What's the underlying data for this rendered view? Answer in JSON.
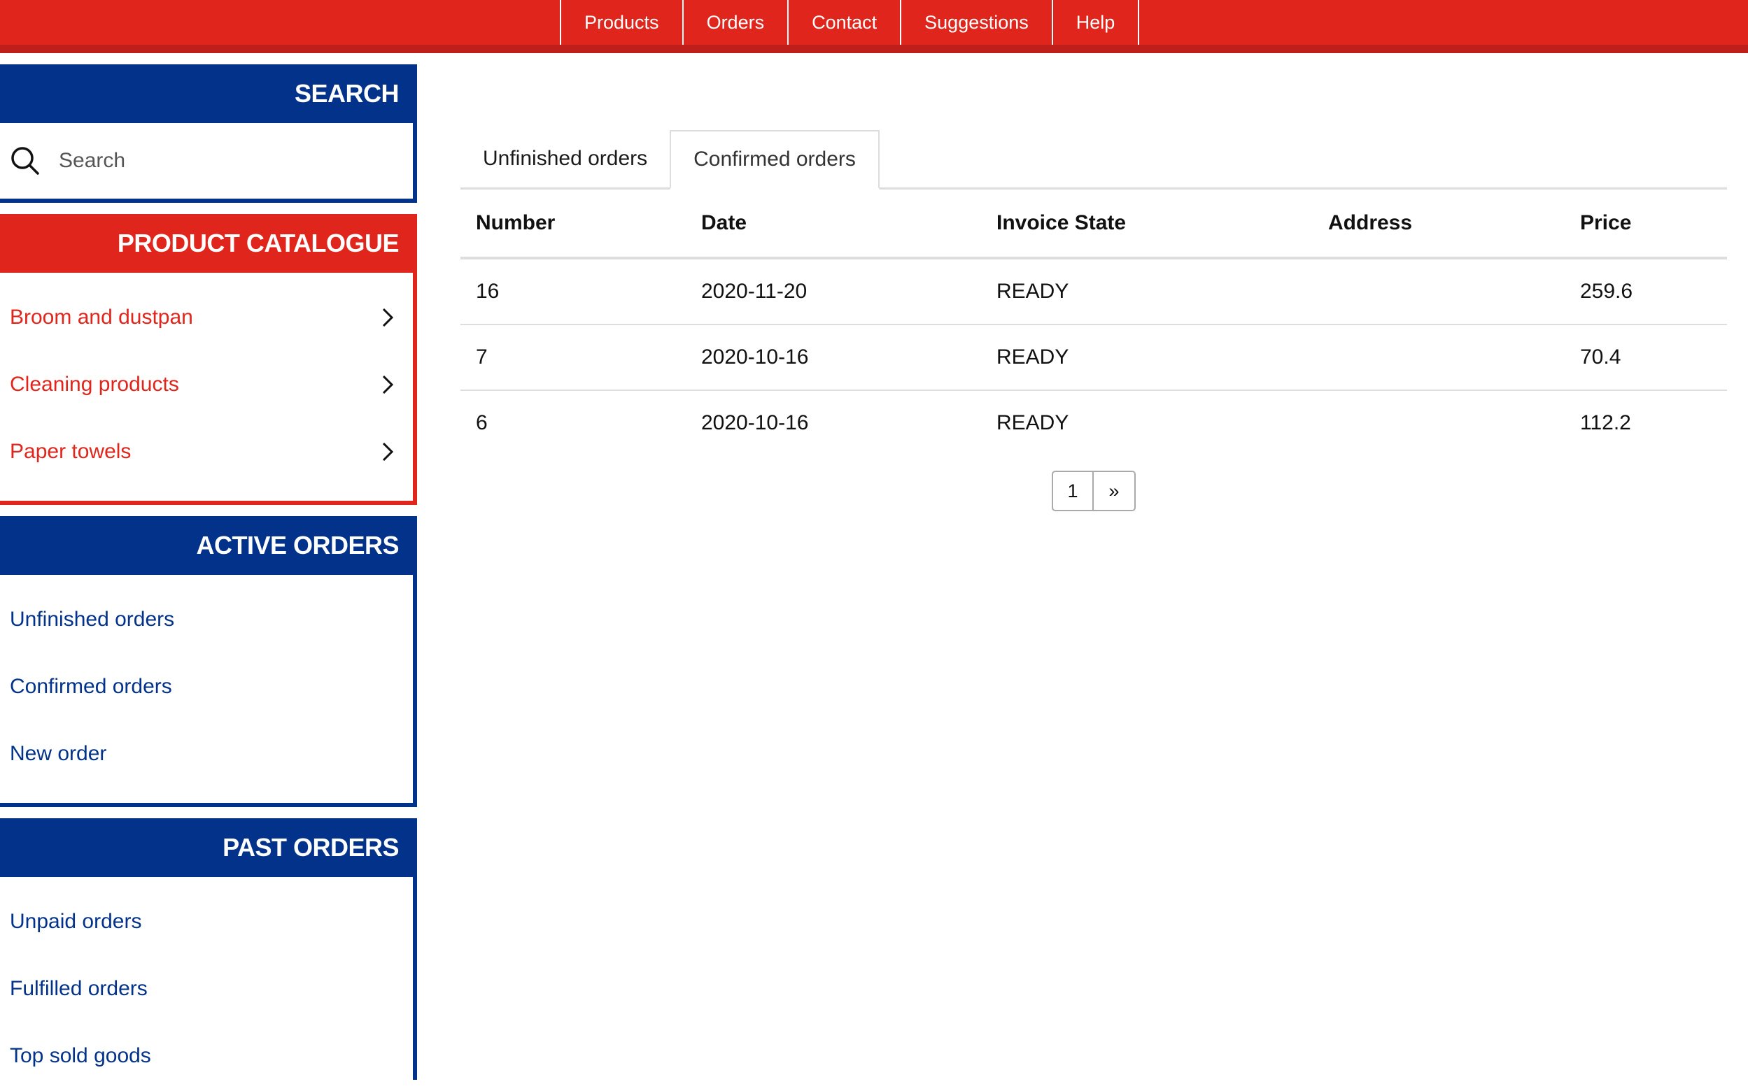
{
  "nav": {
    "items": [
      {
        "label": "Products"
      },
      {
        "label": "Orders"
      },
      {
        "label": "Contact"
      },
      {
        "label": "Suggestions"
      },
      {
        "label": "Help"
      }
    ]
  },
  "sidebar": {
    "search": {
      "title": "SEARCH",
      "placeholder": "Search"
    },
    "catalogue": {
      "title": "PRODUCT CATALOGUE",
      "items": [
        {
          "label": "Broom and dustpan"
        },
        {
          "label": "Cleaning products"
        },
        {
          "label": "Paper towels"
        }
      ]
    },
    "active_orders": {
      "title": "ACTIVE ORDERS",
      "items": [
        {
          "label": "Unfinished orders"
        },
        {
          "label": "Confirmed orders"
        },
        {
          "label": "New order"
        }
      ]
    },
    "past_orders": {
      "title": "PAST ORDERS",
      "items": [
        {
          "label": "Unpaid orders"
        },
        {
          "label": "Fulfilled orders"
        },
        {
          "label": "Top sold goods"
        }
      ]
    }
  },
  "main": {
    "tabs": [
      {
        "label": "Unfinished orders"
      },
      {
        "label": "Confirmed orders"
      }
    ],
    "table": {
      "headers": [
        "Number",
        "Date",
        "Invoice State",
        "Address",
        "Price"
      ],
      "rows": [
        [
          "16",
          "2020-11-20",
          "READY",
          "",
          "259.6"
        ],
        [
          "7",
          "2020-10-16",
          "READY",
          "",
          "70.4"
        ],
        [
          "6",
          "2020-10-16",
          "READY",
          "",
          "112.2"
        ]
      ]
    },
    "pagination": {
      "page": "1",
      "next": "»"
    }
  },
  "colors": {
    "brand_red": "#e0251c",
    "brand_blue": "#02328a"
  }
}
